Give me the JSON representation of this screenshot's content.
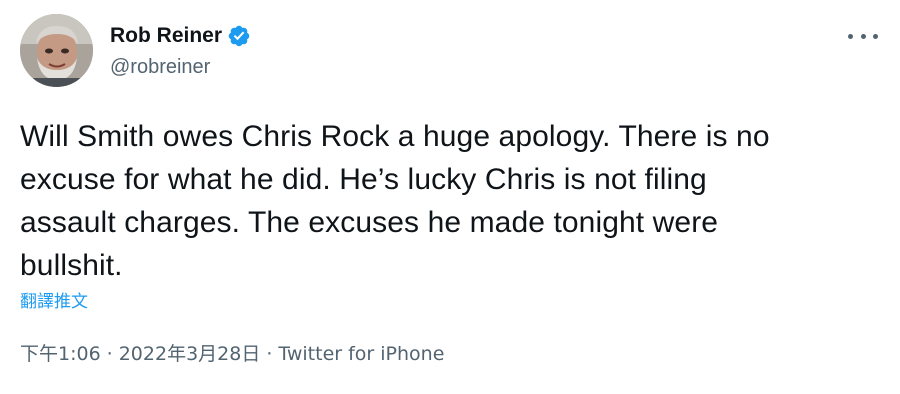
{
  "author": {
    "display_name": "Rob Reiner",
    "handle": "@robreiner",
    "verified": true,
    "avatar_icon": "user-avatar-photo",
    "verified_icon": "verified-badge-icon",
    "verified_color": "#1d9bf0"
  },
  "more_icon": "more-options-icon",
  "tweet": {
    "text": "Will Smith owes Chris Rock a huge apology. There is no\nexcuse for what he did. He’s lucky Chris is not filing\nassault charges. The excuses he made tonight were\nbullshit."
  },
  "translate_label": "翻譯推文",
  "meta": {
    "time": "下午1:06",
    "separator": "·",
    "date": "2022年3月28日",
    "source": "Twitter for iPhone"
  },
  "colors": {
    "text": "#0f1419",
    "secondary": "#536471",
    "link": "#1d9bf0"
  }
}
